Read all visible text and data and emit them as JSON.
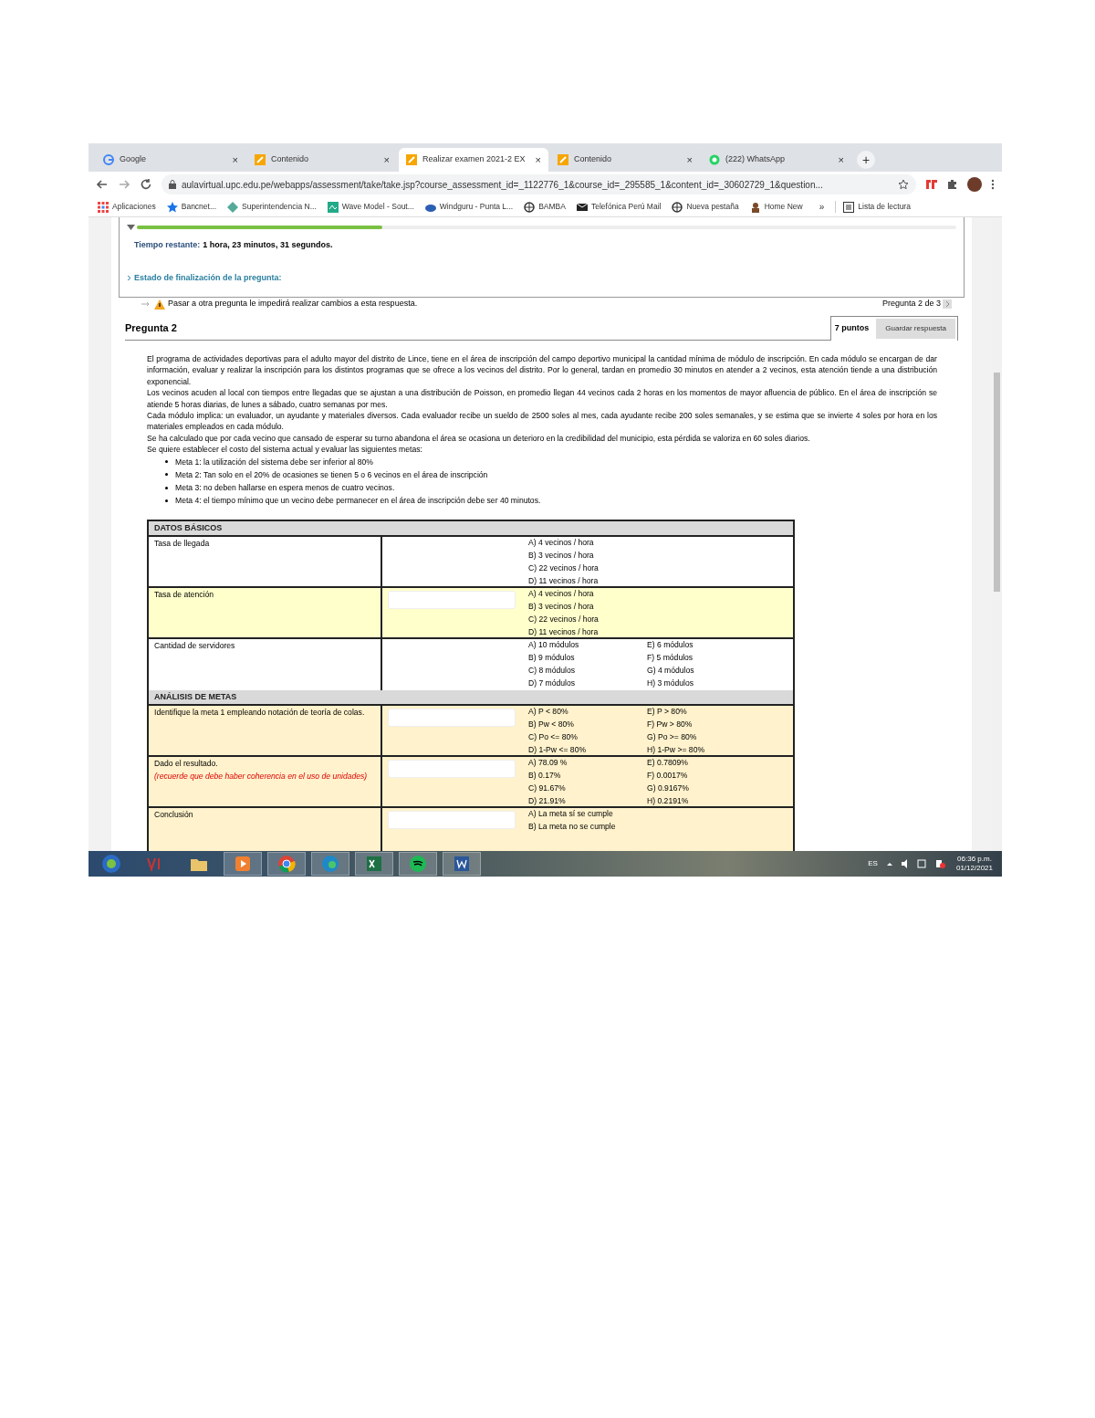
{
  "browser": {
    "tabs": [
      {
        "title": "Google",
        "selected": false
      },
      {
        "title": "Contenido",
        "selected": false
      },
      {
        "title": "Realizar examen 2021-2 EX",
        "selected": true
      },
      {
        "title": "Contenido",
        "selected": false
      },
      {
        "title": "(222) WhatsApp",
        "selected": false
      }
    ],
    "close_label": "×",
    "new_tab_label": "+",
    "url": "aulavirtual.upc.edu.pe/webapps/assessment/take/take.jsp?course_assessment_id=_1122776_1&course_id=_295585_1&content_id=_30602729_1&question...",
    "bookmarks": [
      "Aplicaciones",
      "Bancnet...",
      "Superintendencia N...",
      "Wave Model - Sout...",
      "Windguru - Punta L...",
      "BAMBA",
      "Telefónica Perú Mail",
      "Nueva pestaña",
      "Home New"
    ],
    "more_bookmarks": "»",
    "reading_list": "Lista de lectura"
  },
  "timer": {
    "level": 0.3,
    "label": "Tiempo restante:",
    "value": "1 hora, 23 minutos, 31 segundos."
  },
  "status_link": "Estado de finalización de la pregunta:",
  "warning": "Pasar a otra pregunta le impedirá realizar cambios a esta respuesta.",
  "pager": "Pregunta 2 de 3",
  "question": {
    "title": "Pregunta 2",
    "points": "7 puntos",
    "save_button": "Guardar respuesta",
    "paragraphs": [
      "El programa de actividades deportivas para el adulto mayor del distrito de Lince, tiene en el área de inscripción del campo deportivo municipal la cantidad mínima de módulo de inscripción. En cada módulo se encargan de dar información, evaluar y realizar la inscripción para los distintos programas que se ofrece a los vecinos del distrito. Por lo general, tardan en promedio 30 minutos en atender a 2 vecinos, esta atención tiende a una distribución exponencial.",
      "Los vecinos acuden al local con tiempos entre llegadas que se ajustan a una distribución de Poisson, en promedio llegan 44 vecinos cada 2 horas en los momentos de mayor afluencia de público. En el área de inscripción se atiende 5 horas diarias, de lunes a sábado, cuatro semanas por mes.",
      "Cada módulo implica: un evaluador, un ayudante y materiales diversos. Cada evaluador recibe un sueldo de 2500 soles al mes, cada ayudante recibe 200 soles semanales, y se estima que se invierte 4 soles por hora en los materiales empleados en cada módulo.",
      "Se ha calculado que por cada vecino que cansado de esperar su turno abandona el área se ocasiona un deterioro en la credibilidad del municipio, esta pérdida se valoriza en 60 soles diarios.",
      "Se quiere establecer el costo del sistema actual y evaluar las siguientes metas:"
    ],
    "goals": [
      "Meta 1: la utilización del sistema debe ser inferior al 80%",
      "Meta 2: Tan solo en el 20% de ocasiones se tienen 5 o 6 vecinos en el área de inscripción",
      "Meta 3: no deben hallarse en espera menos de cuatro vecinos.",
      "Meta 4: el tiempo mínimo que un vecino debe permanecer en el área de inscripción debe ser 40 minutos."
    ]
  },
  "table": [
    {
      "kind": "header",
      "label": "DATOS BÁSICOS"
    },
    {
      "kind": "row",
      "label": "Tasa de llegada",
      "color": "#ffffff",
      "input": false,
      "options": [
        "A) 4 vecinos / hora",
        "B) 3 vecinos / hora",
        "C) 22 vecinos / hora",
        "D) 11 vecinos / hora"
      ]
    },
    {
      "kind": "row",
      "label": "Tasa de atención",
      "color": "#ffffcc",
      "input": true,
      "options": [
        "A) 4 vecinos / hora",
        "B) 3 vecinos / hora",
        "C) 22 vecinos / hora",
        "D) 11 vecinos / hora"
      ]
    },
    {
      "kind": "row",
      "label": "Cantidad de servidores",
      "color": "#ffffff",
      "input": false,
      "options": [
        "A) 10 módulos",
        "E) 6 módulos",
        "B) 9 módulos",
        "F) 5 módulos",
        "C) 8 módulos",
        "G) 4 módulos",
        "D) 7 módulos",
        "H) 3 módulos"
      ]
    },
    {
      "kind": "header",
      "label": "ANÁLISIS DE METAS"
    },
    {
      "kind": "row",
      "label": "Identifique la meta 1 empleando notación de teoría de colas.",
      "color": "#fff2cc",
      "input": true,
      "options": [
        "A) P < 80%",
        "E) P > 80%",
        "B) Pw < 80%",
        "F) Pw > 80%",
        "C) Po <= 80%",
        "G) Po >= 80%",
        "D) 1-Pw <= 80%",
        "H) 1-Pw >= 80%"
      ]
    },
    {
      "kind": "row",
      "label": "Dado el resultado.",
      "note": "(recuerde que debe haber coherencia en el uso de unidades)",
      "color": "#fff2cc",
      "input": true,
      "options": [
        "A) 78.09 %",
        "E) 0.7809%",
        "B) 0.17%",
        "F) 0.0017%",
        "C) 91.67%",
        "G) 0.9167%",
        "D) 21.91%",
        "H) 0.2191%"
      ]
    },
    {
      "kind": "row",
      "label": "Conclusión",
      "color": "#fff2cc",
      "input": true,
      "options": [
        "A) La meta sí se cumple",
        "B) La meta no se cumple"
      ]
    }
  ],
  "taskbar": {
    "language": "ES",
    "time": "06:36 p.m.",
    "date": "01/12/2021"
  }
}
